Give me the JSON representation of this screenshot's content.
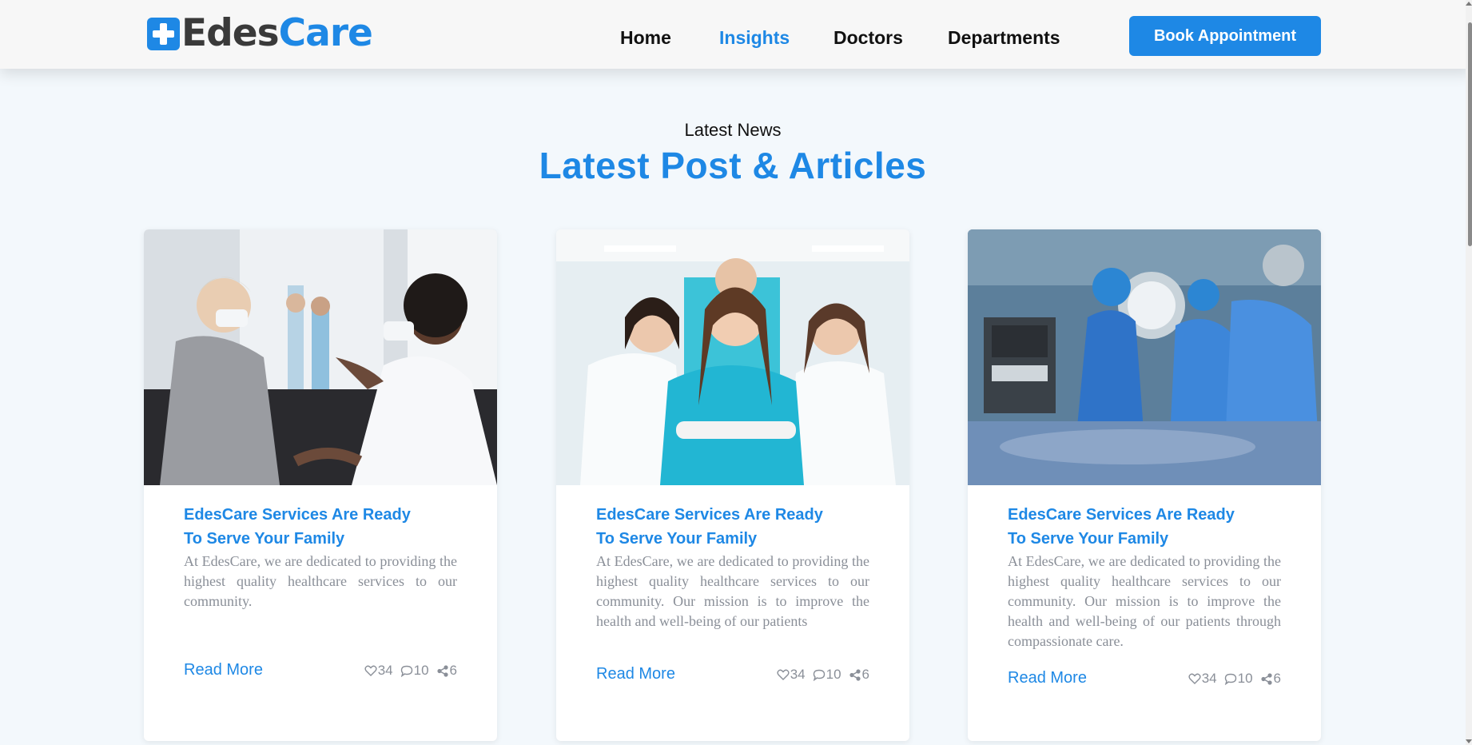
{
  "header": {
    "logo_part1": "Edes",
    "logo_part2": "Care",
    "nav": [
      {
        "label": "Home"
      },
      {
        "label": "Insights"
      },
      {
        "label": "Doctors"
      },
      {
        "label": "Departments"
      }
    ],
    "cta_label": "Book Appointment"
  },
  "section": {
    "eyebrow": "Latest News",
    "title": "Latest Post & Articles"
  },
  "cards": [
    {
      "title_line1": "EdesCare Services Are Ready",
      "title_line2": "To Serve Your Family",
      "text": "At EdesCare, we are dedicated to providing the highest quality healthcare services to our community.",
      "read_more": "Read More",
      "likes": "34",
      "comments": "10",
      "shares": "6"
    },
    {
      "title_line1": "EdesCare Services Are Ready",
      "title_line2": "To Serve Your Family",
      "text": "At EdesCare, we are dedicated to providing the highest quality healthcare services to our community. Our mission is to improve the health and well-being of our patients",
      "read_more": "Read More",
      "likes": "34",
      "comments": "10",
      "shares": "6"
    },
    {
      "title_line1": "EdesCare Services Are Ready",
      "title_line2": "To Serve Your Family",
      "text": "At EdesCare, we are dedicated to providing the highest quality healthcare services to our community. Our mission is to improve the health and well-being of our patients through compassionate care.",
      "read_more": "Read More",
      "likes": "34",
      "comments": "10",
      "shares": "6"
    }
  ],
  "colors": {
    "brand": "#1e88e5",
    "text_dark": "#111111",
    "text_muted": "#8a8f98",
    "page_bg": "#f3f8fc"
  },
  "icons": [
    "heart-icon",
    "comment-icon",
    "share-icon",
    "logo-cross-icon"
  ]
}
